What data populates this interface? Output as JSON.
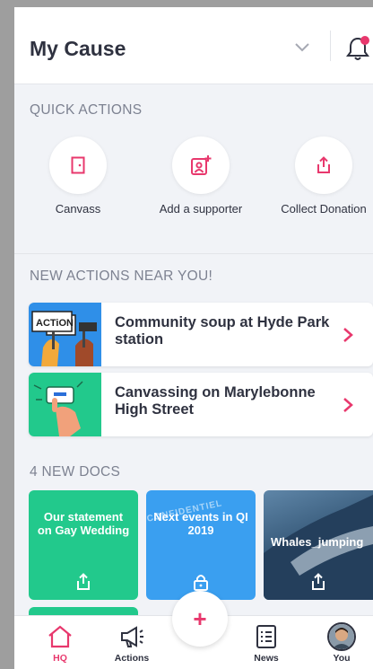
{
  "header": {
    "title": "My Cause"
  },
  "quick_actions": {
    "label": "QUICK ACTIONS",
    "items": [
      {
        "label": "Canvass",
        "icon": "door-icon"
      },
      {
        "label": "Add a supporter",
        "icon": "add-supporter-icon"
      },
      {
        "label": "Collect Donation",
        "icon": "share-icon"
      }
    ]
  },
  "new_actions": {
    "label": "NEW ACTIONS NEAR YOU!",
    "items": [
      {
        "title": "Community soup at Hyde Park station",
        "thumb_text": "ACTiON",
        "thumb_bg": "#2f8fe8"
      },
      {
        "title": "Canvassing on Marylebonne High Street",
        "thumb_bg": "#22c98c"
      }
    ]
  },
  "docs": {
    "label": "4 NEW DOCS",
    "items": [
      {
        "title": "Our statement on Gay Wedding",
        "bg": "#22c98c",
        "icon": "share-icon"
      },
      {
        "title": "Next events in QI 2019",
        "stamp": "CONFIDENTIEL",
        "bg": "#3a9ff0",
        "icon": "lock-icon"
      },
      {
        "title": "Whales_jumping",
        "bg": "#2e5070",
        "icon": "share-icon"
      }
    ]
  },
  "tabbar": {
    "items": [
      {
        "label": "HQ",
        "active": true
      },
      {
        "label": "Actions"
      },
      {
        "label": "News"
      },
      {
        "label": "You"
      }
    ]
  },
  "colors": {
    "accent": "#e8386d",
    "green": "#22c98c",
    "blue": "#3a9ff0"
  }
}
